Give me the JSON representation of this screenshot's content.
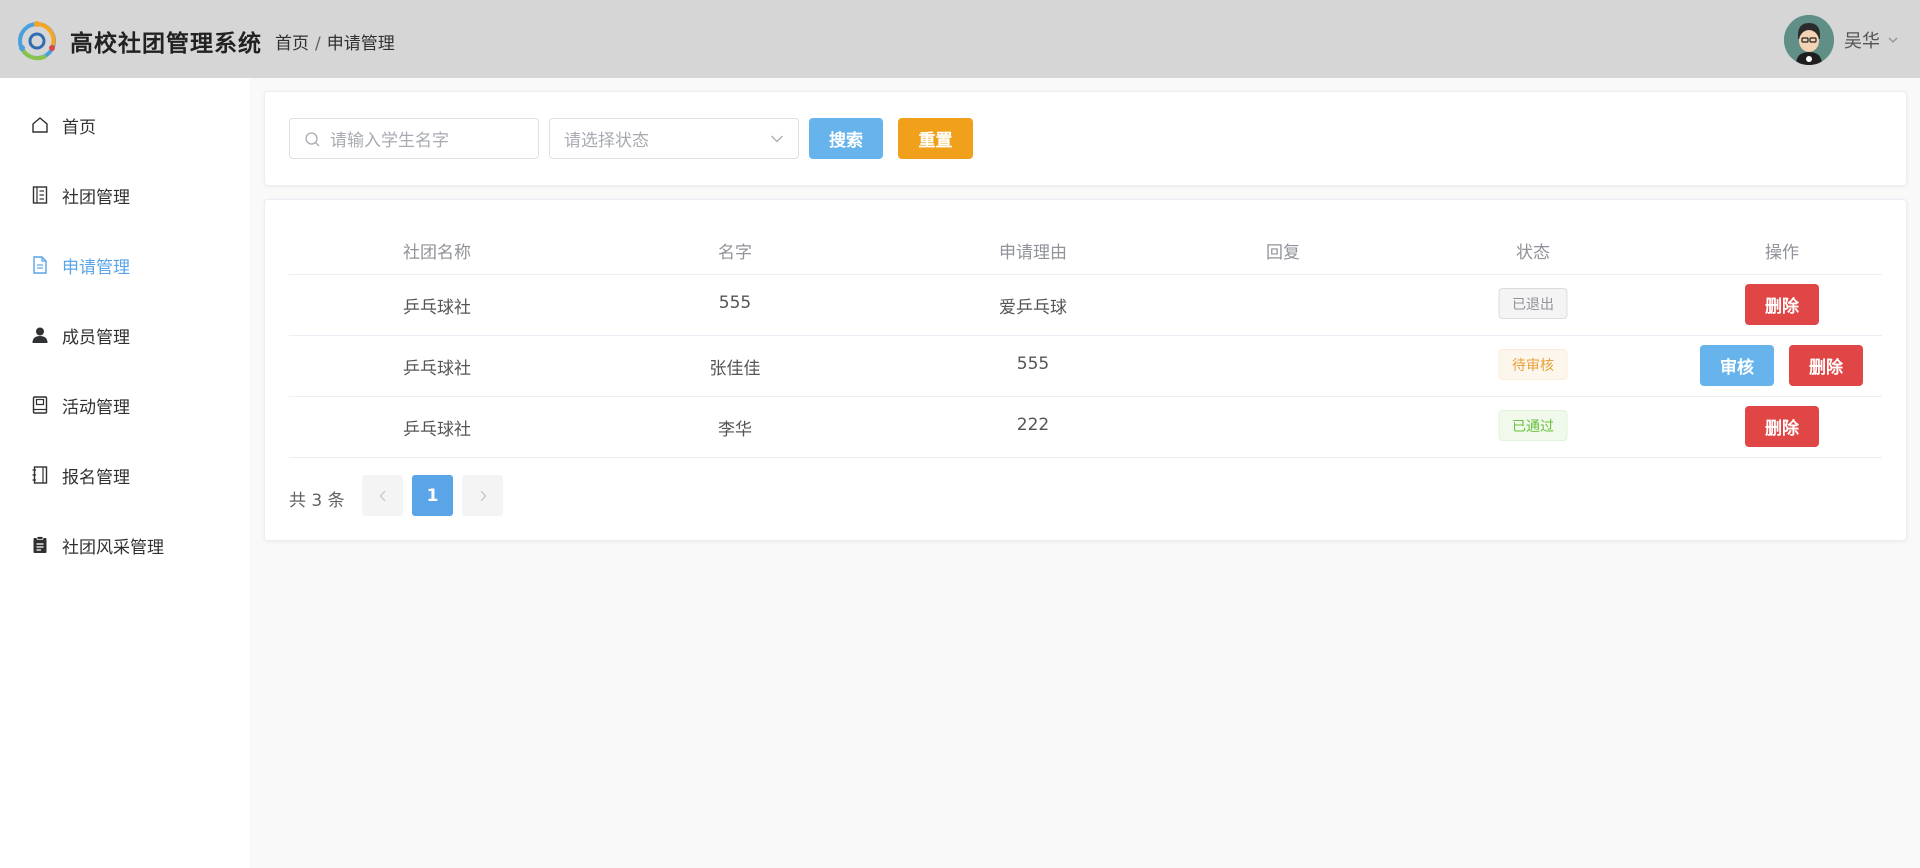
{
  "header": {
    "app_title": "高校社团管理系统",
    "breadcrumb": [
      "首页",
      "申请管理"
    ],
    "breadcrumb_sep": "/",
    "user_name": "吴华"
  },
  "sidebar": {
    "items": [
      {
        "label": "首页",
        "icon": "home-icon",
        "active": false
      },
      {
        "label": "社团管理",
        "icon": "notebook-icon",
        "active": false
      },
      {
        "label": "申请管理",
        "icon": "document-icon",
        "active": true
      },
      {
        "label": "成员管理",
        "icon": "user-icon",
        "active": false
      },
      {
        "label": "活动管理",
        "icon": "book-icon",
        "active": false
      },
      {
        "label": "报名管理",
        "icon": "register-book-icon",
        "active": false
      },
      {
        "label": "社团风采管理",
        "icon": "clipboard-icon",
        "active": false
      }
    ],
    "active_color": "#5aa4e8"
  },
  "search": {
    "name_placeholder": "请输入学生名字",
    "status_placeholder": "请选择状态",
    "search_label": "搜索",
    "reset_label": "重置"
  },
  "table": {
    "columns": [
      "社团名称",
      "名字",
      "申请理由",
      "回复",
      "状态",
      "操作"
    ],
    "rows": [
      {
        "club": "乒乓球社",
        "name": "555",
        "reason": "爱乒乓球",
        "reply": "",
        "status": "已退出",
        "status_type": "quit",
        "actions": [
          "删除"
        ]
      },
      {
        "club": "乒乓球社",
        "name": "张佳佳",
        "reason": "555",
        "reply": "",
        "status": "待审核",
        "status_type": "pending",
        "actions": [
          "审核",
          "删除"
        ]
      },
      {
        "club": "乒乓球社",
        "name": "李华",
        "reason": "222",
        "reply": "",
        "status": "已通过",
        "status_type": "passed",
        "actions": [
          "删除"
        ]
      }
    ]
  },
  "pagination": {
    "total_text": "共 3 条",
    "current_page": "1",
    "prev_icon": "chevron-left-icon",
    "next_icon": "chevron-right-icon"
  },
  "colors": {
    "primary": "#67b3ec",
    "warning": "#f0a01a",
    "danger": "#e04646",
    "header_bg": "#d6d6d6"
  }
}
